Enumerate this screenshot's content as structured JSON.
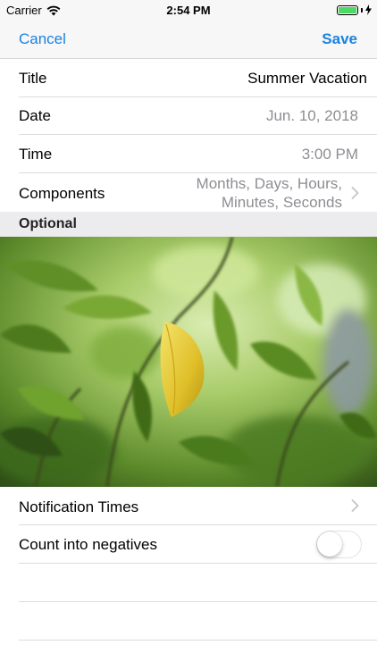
{
  "status_bar": {
    "carrier": "Carrier",
    "time": "2:54 PM"
  },
  "nav": {
    "cancel_label": "Cancel",
    "save_label": "Save"
  },
  "rows": {
    "title": {
      "label": "Title",
      "value": "Summer Vacation"
    },
    "date": {
      "label": "Date",
      "value": "Jun. 10, 2018"
    },
    "time": {
      "label": "Time",
      "value": "3:00 PM"
    },
    "components": {
      "label": "Components",
      "value_line1": "Months, Days, Hours,",
      "value_line2": "Minutes, Seconds"
    }
  },
  "section": {
    "optional": "Optional"
  },
  "photo": {
    "subject": "leaves"
  },
  "notification": {
    "label": "Notification Times"
  },
  "count_negatives": {
    "label": "Count into negatives",
    "enabled": false
  },
  "colors": {
    "accent": "#1a82e0",
    "battery": "#4cd964",
    "separator": "#dcdcdc"
  }
}
